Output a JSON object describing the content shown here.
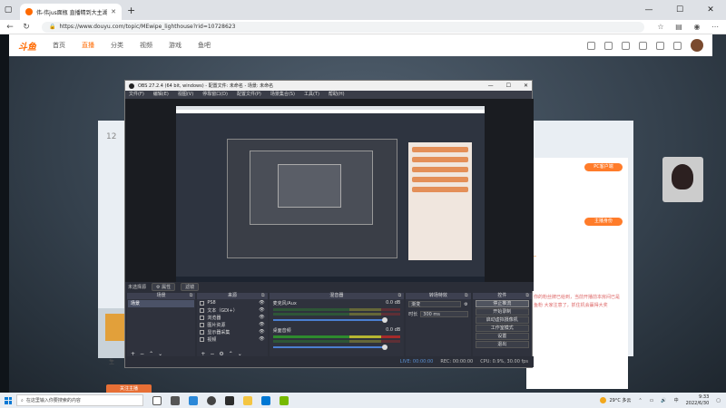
{
  "browser": {
    "tab_title": "伟-伟jus面瓶 直播精到大主湖 -斗",
    "url": "https://www.douyu.com/topic/MEwipe_lighthouse?rid=10728623",
    "win_min": "—",
    "win_max": "☐",
    "win_close": "✕",
    "new_tab": "+"
  },
  "douyu": {
    "logo": "斗鱼",
    "nav": [
      "首页",
      "直播",
      "分类",
      "视频",
      "游戏",
      "鱼吧"
    ],
    "room_number": "12",
    "side_chip_1": "PC客户端",
    "side_chip_2": "主播身份",
    "side_row_1": "一",
    "side_text": "你的粉丝牌已给到，当前开播前本房间已是鱼粉 大家注意了，抓住机会赢得大奖",
    "left_text": "生",
    "orange_btn": "关注主播"
  },
  "obs": {
    "title": "OBS 27.2.4 (64 bit, windows) - 配置文件: 未命名 - 场景: 未命名",
    "menu": [
      "文件(F)",
      "编辑(E)",
      "视图(V)",
      "停靠窗口(D)",
      "配置文件(P)",
      "场景集合(S)",
      "工具(T)",
      "帮助(H)"
    ],
    "scene_row_label": "未选择源",
    "scene_row_btns": [
      "⚙ 属性",
      "滤镜"
    ],
    "docks": {
      "scenes": {
        "title": "场景",
        "items": [
          "场景"
        ]
      },
      "sources": {
        "title": "来源",
        "items": [
          "PS8",
          "文本（GDI+）",
          "浏览器",
          "图片资源",
          "显示器采集",
          "视频"
        ]
      },
      "mixer": {
        "title": "混音器",
        "channels": [
          {
            "name": "麦克风/Aux",
            "db": "0.0 dB"
          },
          {
            "name": "桌面音频",
            "db": "0.0 dB"
          }
        ]
      },
      "transitions": {
        "title": "转场特效",
        "type": "渐变",
        "duration_label": "时长",
        "duration": "300 ms"
      },
      "controls": {
        "title": "控件",
        "buttons": [
          "停止推流",
          "开始录制",
          "启动虚拟摄像机",
          "工作室模式",
          "设置",
          "退出"
        ]
      }
    },
    "status": {
      "live": "LIVE: 00:00:00",
      "rec": "REC: 00:00:00",
      "cpu": "CPU: 0.9%, 30.00 fps"
    }
  },
  "taskbar": {
    "search_placeholder": "在这里输入你要搜索的内容",
    "weather": "29°C 多云",
    "time": "9:33",
    "date": "2022/6/30"
  }
}
